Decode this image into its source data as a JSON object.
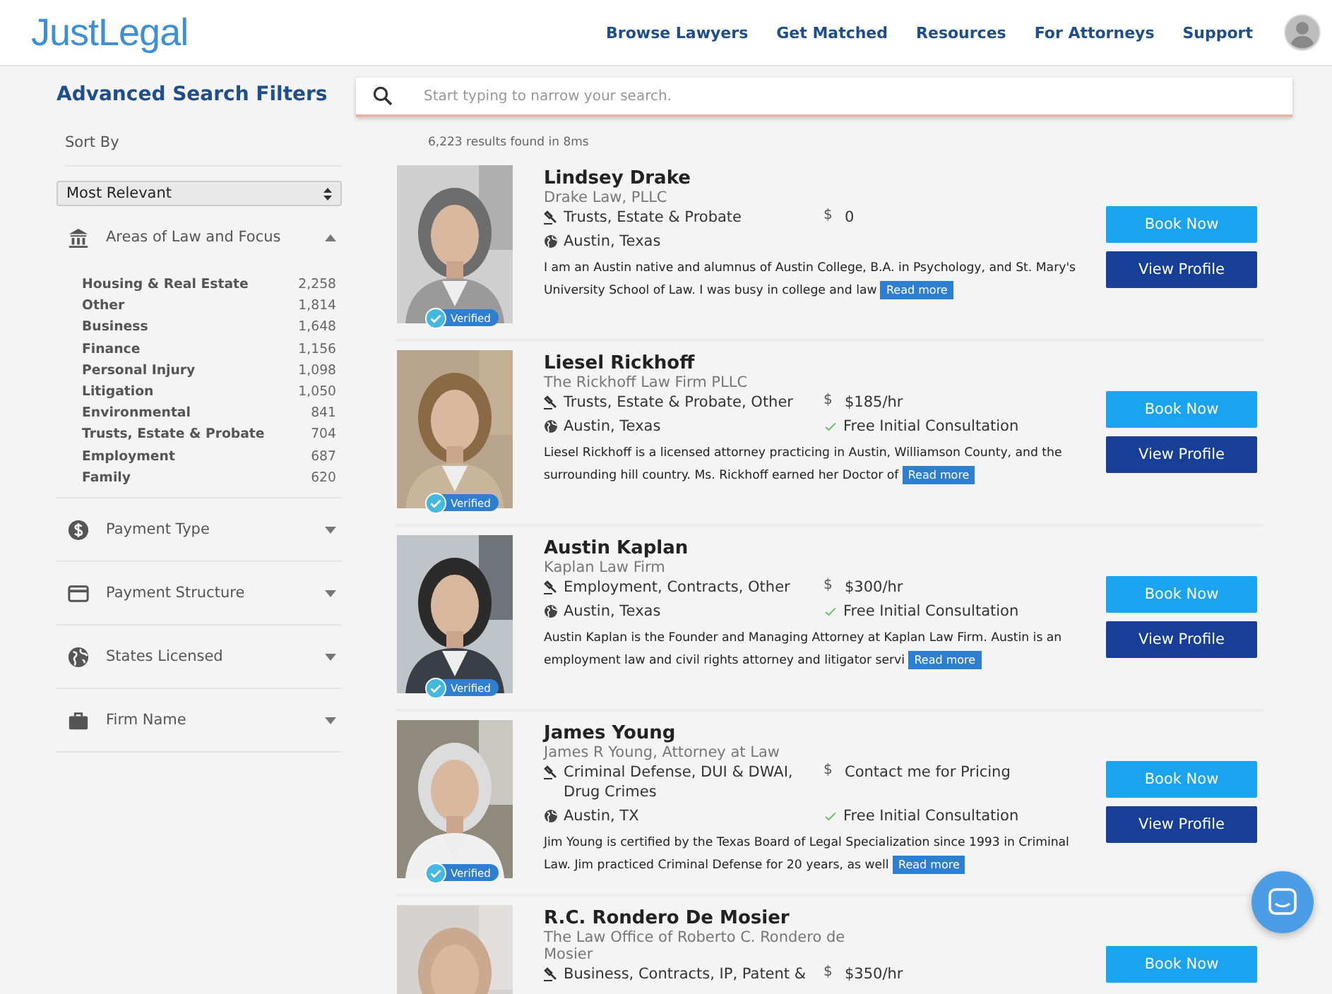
{
  "header": {
    "logo": "JustLegal",
    "nav": [
      "Browse Lawyers",
      "Get Matched",
      "Resources",
      "For Attorneys",
      "Support"
    ]
  },
  "sidebar": {
    "title": "Advanced Search Filters",
    "sort_label": "Sort By",
    "sort_value": "Most Relevant",
    "sections": [
      {
        "label": "Areas of Law and Focus",
        "expanded": true,
        "items": [
          {
            "label": "Housing & Real Estate",
            "count": "2,258"
          },
          {
            "label": "Other",
            "count": "1,814"
          },
          {
            "label": "Business",
            "count": "1,648"
          },
          {
            "label": "Finance",
            "count": "1,156"
          },
          {
            "label": "Personal Injury",
            "count": "1,098"
          },
          {
            "label": "Litigation",
            "count": "1,050"
          },
          {
            "label": "Environmental",
            "count": "841"
          },
          {
            "label": "Trusts, Estate & Probate",
            "count": "704"
          },
          {
            "label": "Employment",
            "count": "687"
          },
          {
            "label": "Family",
            "count": "620"
          }
        ]
      },
      {
        "label": "Payment Type",
        "expanded": false
      },
      {
        "label": "Payment Structure",
        "expanded": false
      },
      {
        "label": "States Licensed",
        "expanded": false
      },
      {
        "label": "Firm Name",
        "expanded": false
      }
    ]
  },
  "search": {
    "placeholder": "Start typing to narrow your search."
  },
  "results_count": "6,223 results found in 8ms",
  "lawyers": [
    {
      "name": "Lindsey Drake",
      "firm": "Drake Law, PLLC",
      "practice": "Trusts, Estate & Probate",
      "price_symbol": "$",
      "price": "0",
      "location": "Austin, Texas",
      "bio": "I am an Austin native and alumnus of Austin College, B.A. in Psychology, and St. Mary's University School of Law. I was busy in college and law",
      "read_more": "Read more",
      "badge": "Verified",
      "book": "Book Now",
      "profile": "View Profile"
    },
    {
      "name": "Liesel Rickhoff",
      "firm": "The Rickhoff Law Firm PLLC",
      "practice": "Trusts, Estate & Probate, Other",
      "price_symbol": "$",
      "price": "$185/hr",
      "consultation": "Free Initial Consultation",
      "location": "Austin, Texas",
      "bio": "Liesel Rickhoff is a licensed attorney practicing in Austin, Williamson County, and the surrounding hill country. Ms. Rickhoff earned her Doctor of",
      "read_more": "Read more",
      "badge": "Verified",
      "book": "Book Now",
      "profile": "View Profile"
    },
    {
      "name": "Austin Kaplan",
      "firm": "Kaplan Law Firm",
      "practice": "Employment, Contracts, Other",
      "price_symbol": "$",
      "price": "$300/hr",
      "consultation": "Free Initial Consultation",
      "location": "Austin, Texas",
      "bio": "Austin Kaplan is the Founder and Managing Attorney at Kaplan Law Firm. Austin is an employment law and civil rights attorney and litigator servi",
      "read_more": "Read more",
      "badge": "Verified",
      "book": "Book Now",
      "profile": "View Profile"
    },
    {
      "name": "James Young",
      "firm": "James R Young, Attorney at Law",
      "practice": "Criminal Defense, DUI & DWAI, Drug Crimes",
      "price_symbol": "$",
      "price": "Contact me for Pricing",
      "consultation": "Free Initial Consultation",
      "location": "Austin, TX",
      "bio": "Jim Young is certified by the Texas Board of Legal Specialization since 1993 in Criminal Law. Jim practiced Criminal Defense for 20 years, as well",
      "read_more": "Read more",
      "badge": "Verified",
      "book": "Book Now",
      "profile": "View Profile"
    },
    {
      "name": "R.C. Rondero De Mosier",
      "firm": "The Law Office of Roberto C. Rondero de Mosier",
      "practice": "Business, Contracts, IP, Patent &",
      "price_symbol": "$",
      "price": "$350/hr",
      "book": "Book Now"
    }
  ]
}
